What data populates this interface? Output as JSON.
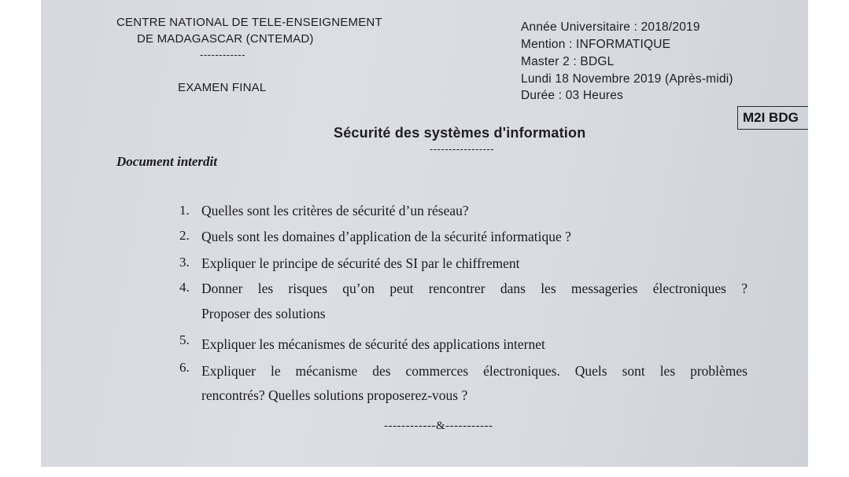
{
  "header": {
    "institution": [
      "CENTRE NATIONAL DE TELE-ENSEIGNEMENT",
      "DE MADAGASCAR (CNTEMAD)"
    ],
    "institution_rule": "------------",
    "exam_type": "EXAMEN FINAL",
    "academic_year": "Année Universitaire : 2018/2019",
    "mention": "Mention : INFORMATIQUE",
    "level": "Master 2 : BDGL",
    "date": "Lundi  18 Novembre 2019 (Après-midi)",
    "duration": "Durée : 03 Heures",
    "code": "M2I BDG"
  },
  "title": "Sécurité des systèmes d'information",
  "title_rule": "-----------------",
  "instruction": "Document interdit",
  "questions": [
    {
      "num": "1.",
      "text": "Quelles sont les critères de sécurité d’un réseau?"
    },
    {
      "num": "2.",
      "text": "Quels sont les domaines d’application de la sécurité informatique ?"
    },
    {
      "num": "3.",
      "text": "Expliquer le principe de sécurité des SI par le chiffrement"
    },
    {
      "num": "4.",
      "text": "Donner les risques qu’on peut rencontrer dans les messageries électroniques ?",
      "cont": "Proposer des solutions"
    },
    {
      "num": "5.",
      "text": "Expliquer les mécanismes de sécurité des applications internet"
    },
    {
      "num": "6.",
      "text": "Expliquer le mécanisme des commerces électroniques. Quels sont les problèmes",
      "cont": "rencontrés? Quelles solutions proposerez-vous ?"
    }
  ],
  "end_mark": "------------&-----------"
}
